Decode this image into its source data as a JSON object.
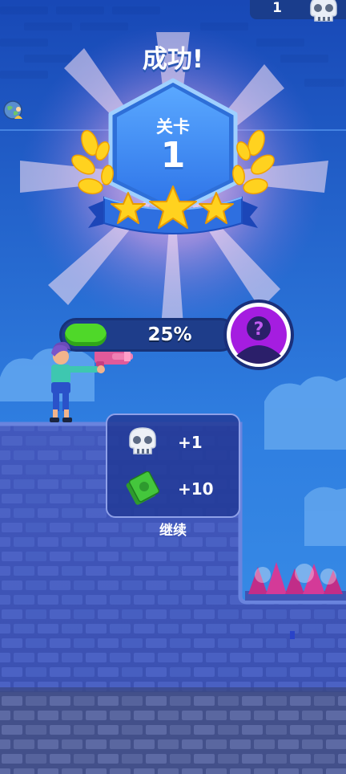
{
  "hud": {
    "skull_count": "1",
    "skull_icon": "skull-icon"
  },
  "result": {
    "title": "成功!"
  },
  "badge": {
    "label": "关卡",
    "number": "1",
    "stars_earned": 3,
    "stars_total": 3
  },
  "progress": {
    "value": 0.25,
    "text": "25%",
    "fill_color": "#4fd829"
  },
  "mystery_reward": {
    "icon": "question-mark-silhouette-icon",
    "ring_color": "#a51de0"
  },
  "rewards": [
    {
      "icon": "skull-icon",
      "value": "+1"
    },
    {
      "icon": "cash-icon",
      "value": "+10"
    }
  ],
  "continue_label": "继续",
  "colors": {
    "sky": "#1c58c6",
    "wall": "#3d54b6",
    "badge_blue": "#3b8ef0",
    "gold": "#ffd21f"
  }
}
